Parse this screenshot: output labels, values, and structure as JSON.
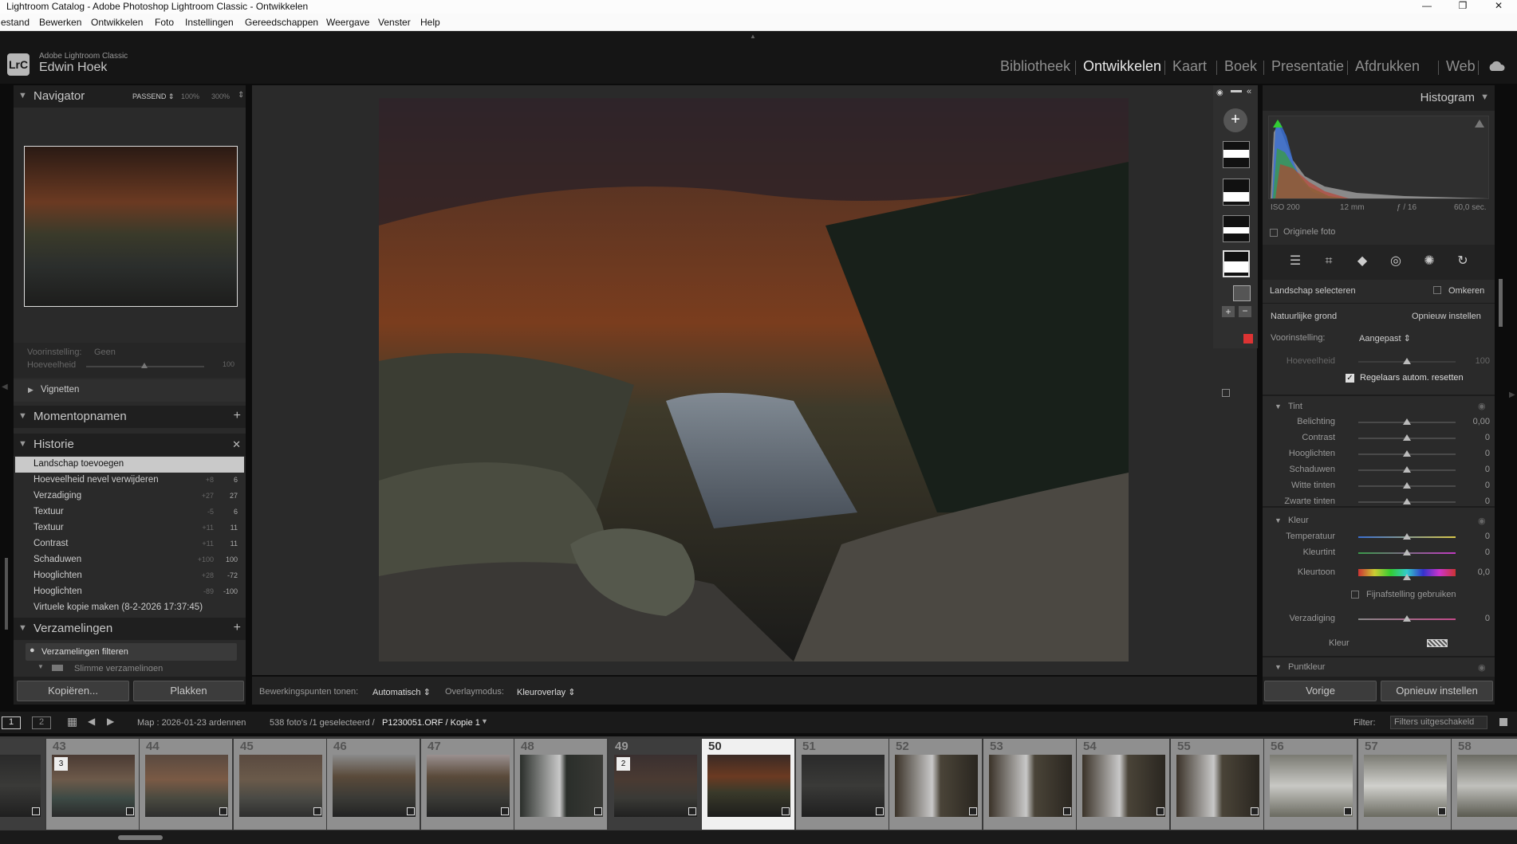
{
  "window": {
    "title": "Lightroom Catalog - Adobe Photoshop Lightroom Classic - Ontwikkelen",
    "minimize": "—",
    "maximize": "❐",
    "close": "✕"
  },
  "menu": [
    "estand",
    "Bewerken",
    "Ontwikkelen",
    "Foto",
    "Instellingen",
    "Gereedschappen",
    "Weergave",
    "Venster",
    "Help"
  ],
  "identity": {
    "logo": "LrC",
    "app_name": "Adobe Lightroom Classic",
    "user": "Edwin Hoek"
  },
  "modules": [
    "Bibliotheek",
    "Ontwikkelen",
    "Kaart",
    "Boek",
    "Presentatie",
    "Afdrukken",
    "Web"
  ],
  "active_module": "Ontwikkelen",
  "navigator": {
    "title": "Navigator",
    "zoom": "PASSEND ⇕",
    "z1": "100%",
    "z2": "300%"
  },
  "preset_section": {
    "label": "Voorinstelling:",
    "value": "Geen",
    "amount_label": "Hoeveelheid",
    "amount_value": "100",
    "amount_fraction": 0.5
  },
  "vignetten": "Vignetten",
  "snapshots": {
    "title": "Momentopnamen",
    "add": "+"
  },
  "history": {
    "title": "Historie",
    "clear": "✕",
    "items": [
      {
        "name": "Landschap toevoegen",
        "delta": "",
        "value": "",
        "selected": true
      },
      {
        "name": "Hoeveelheid nevel verwijderen",
        "delta": "+8",
        "value": "6"
      },
      {
        "name": "Verzadiging",
        "delta": "+27",
        "value": "27"
      },
      {
        "name": "Textuur",
        "delta": "-5",
        "value": "6"
      },
      {
        "name": "Textuur",
        "delta": "+11",
        "value": "11"
      },
      {
        "name": "Contrast",
        "delta": "+11",
        "value": "11"
      },
      {
        "name": "Schaduwen",
        "delta": "+100",
        "value": "100"
      },
      {
        "name": "Hooglichten",
        "delta": "+28",
        "value": "-72"
      },
      {
        "name": "Hooglichten",
        "delta": "-89",
        "value": "-100"
      },
      {
        "name": "Virtuele kopie maken (8-2-2026 17:37:45)",
        "delta": "",
        "value": ""
      }
    ]
  },
  "collections": {
    "title": "Verzamelingen",
    "add": "+",
    "filter": "Verzamelingen filteren",
    "smart": "Slimme verzamelingen"
  },
  "left_buttons": {
    "copy": "Kopiëren...",
    "paste": "Plakken"
  },
  "toolbar": {
    "pins_label": "Bewerkingspunten tonen:",
    "pins_value": "Automatisch ⇕",
    "overlay_label": "Overlaymodus:",
    "overlay_value": "Kleuroverlay ⇕"
  },
  "histogram": {
    "title": "Histogram",
    "iso": "ISO 200",
    "focal": "12 mm",
    "aperture": "ƒ / 16",
    "shutter": "60,0 sec.",
    "original": "Originele foto"
  },
  "mask": {
    "select": "Landschap selecteren",
    "invert": "Omkeren",
    "subject": "Natuurlijke grond",
    "reset": "Opnieuw instellen",
    "preset_label": "Voorinstelling:",
    "preset_value": "Aangepast ⇕",
    "amount_label": "Hoeveelheid",
    "amount_value": "100",
    "amount_fraction": 0.5,
    "auto_reset": "Regelaars autom. resetten"
  },
  "tone": {
    "title": "Tint",
    "sliders": [
      {
        "label": "Belichting",
        "value": "0,00",
        "fraction": 0.5
      },
      {
        "label": "Contrast",
        "value": "0",
        "fraction": 0.5
      },
      {
        "label": "Hooglichten",
        "value": "0",
        "fraction": 0.5
      },
      {
        "label": "Schaduwen",
        "value": "0",
        "fraction": 0.5
      },
      {
        "label": "Witte tinten",
        "value": "0",
        "fraction": 0.5
      },
      {
        "label": "Zwarte tinten",
        "value": "0",
        "fraction": 0.5
      }
    ]
  },
  "color": {
    "title": "Kleur",
    "temp": {
      "label": "Temperatuur",
      "value": "0",
      "fraction": 0.5
    },
    "tint": {
      "label": "Kleurtint",
      "value": "0",
      "fraction": 0.5
    },
    "hue": {
      "label": "Kleurtoon",
      "value": "0,0",
      "fraction": 0.5
    },
    "fine": "Fijnafstelling gebruiken",
    "sat": {
      "label": "Verzadiging",
      "value": "0",
      "fraction": 0.5
    },
    "color_label": "Kleur"
  },
  "point_color": "Puntkleur",
  "right_buttons": {
    "prev": "Vorige",
    "reset": "Opnieuw instellen"
  },
  "filmbar": {
    "screen1": "1",
    "screen2": "2",
    "folder": "Map : 2026-01-23 ardennen",
    "count": "538 foto's /1 geselecteerd /",
    "file": "P1230051.ORF / Kopie 1",
    "filter_label": "Filter:",
    "filter_value": "Filters uitgeschakeld"
  },
  "filmstrip": [
    {
      "num": "",
      "tone": "dark",
      "badge": ""
    },
    {
      "num": "43",
      "tone": "light",
      "badge": "3"
    },
    {
      "num": "44",
      "tone": "light",
      "badge": ""
    },
    {
      "num": "45",
      "tone": "light",
      "badge": ""
    },
    {
      "num": "46",
      "tone": "light",
      "badge": ""
    },
    {
      "num": "47",
      "tone": "light",
      "badge": ""
    },
    {
      "num": "48",
      "tone": "light",
      "badge": ""
    },
    {
      "num": "49",
      "tone": "dark",
      "badge": "2"
    },
    {
      "num": "50",
      "tone": "selected",
      "badge": ""
    },
    {
      "num": "51",
      "tone": "light",
      "badge": ""
    },
    {
      "num": "52",
      "tone": "light",
      "badge": ""
    },
    {
      "num": "53",
      "tone": "light",
      "badge": ""
    },
    {
      "num": "54",
      "tone": "light",
      "badge": ""
    },
    {
      "num": "55",
      "tone": "light",
      "badge": ""
    },
    {
      "num": "56",
      "tone": "light",
      "badge": ""
    },
    {
      "num": "57",
      "tone": "light",
      "badge": ""
    },
    {
      "num": "58",
      "tone": "light",
      "badge": ""
    }
  ]
}
